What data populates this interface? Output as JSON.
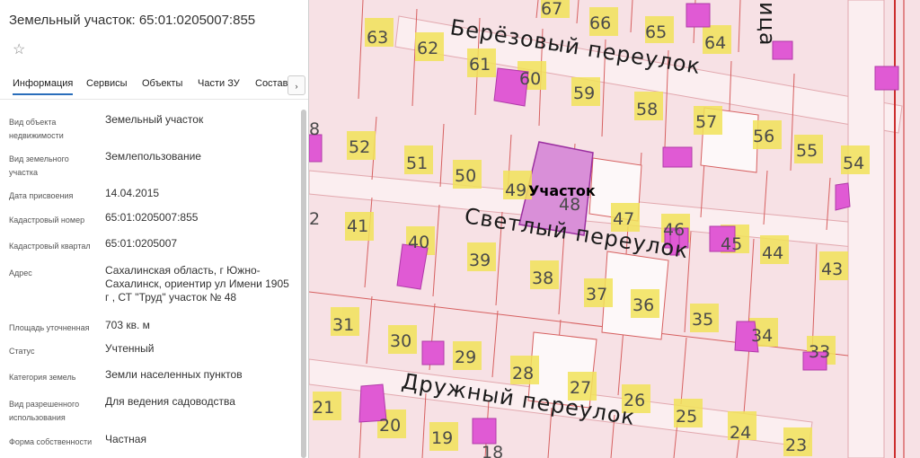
{
  "panel": {
    "title": "Земельный участок: 65:01:0205007:855",
    "star_icon": "star-outline-icon",
    "tabs": [
      "Информация",
      "Сервисы",
      "Объекты",
      "Части ЗУ",
      "Состав"
    ],
    "tab_arrow": "›",
    "rows": [
      {
        "key": "Вид объекта недвижимости",
        "value": "Земельный участок"
      },
      {
        "key": "Вид земельного участка",
        "value": "Землепользование"
      },
      {
        "key": "Дата присвоения",
        "value": "14.04.2015"
      },
      {
        "key": "Кадастровый номер",
        "value": "65:01:0205007:855"
      },
      {
        "key": "Кадастровый квартал",
        "value": "65:01:0205007"
      },
      {
        "key": "Адрес",
        "value": "Сахалинская область, г Южно-Сахалинск, ориентир ул Имени 1905 г , СТ \"Труд\" участок № 48"
      },
      {
        "key": "Площадь уточненная",
        "value": "703 кв. м"
      },
      {
        "key": "Статус",
        "value": "Учтенный"
      },
      {
        "key": "Категория земель",
        "value": "Земли населенных пунктов"
      },
      {
        "key": "Вид разрешенного использования",
        "value": "Для ведения садоводства"
      },
      {
        "key": "Форма собственности",
        "value": "Частная"
      }
    ]
  },
  "map": {
    "streets": [
      "Берёзовый переулок",
      "Светлый переулок",
      "Дружный переулок",
      "ица"
    ],
    "parcel_label": "Участок",
    "lots": [
      "63",
      "67",
      "66",
      "65",
      "64",
      "62",
      "61",
      "60",
      "59",
      "58",
      "57",
      "56",
      "55",
      "54",
      "52",
      "51",
      "50",
      "49",
      "48",
      "47",
      "46",
      "45",
      "44",
      "43",
      "41",
      "40",
      "39",
      "38",
      "37",
      "36",
      "35",
      "34",
      "33",
      "31",
      "30",
      "29",
      "28",
      "27",
      "26",
      "25",
      "24",
      "23",
      "21",
      "20",
      "19",
      "18",
      "8",
      "2"
    ],
    "colors": {
      "building": "#e05ad4",
      "selected_parcel": "#d98fd8",
      "lot_fill": "#f7e1e5",
      "boundary": "#d64545",
      "lot_number_bg": "#f2e35a"
    }
  }
}
